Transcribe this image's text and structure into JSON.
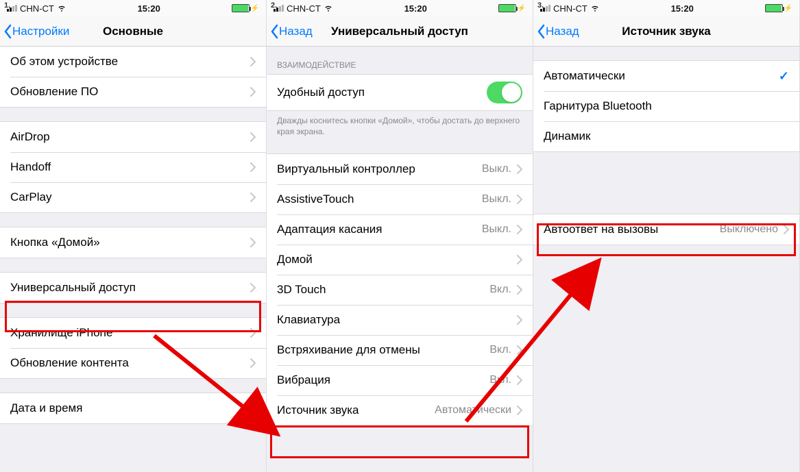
{
  "steps": {
    "s1": "1.",
    "s2": "2.",
    "s3": "3."
  },
  "status": {
    "carrier": "CHN-CT",
    "time": "15:20"
  },
  "screen1": {
    "back": "Настройки",
    "title": "Основные",
    "g1": {
      "r0": "Об этом устройстве",
      "r1": "Обновление ПО"
    },
    "g2": {
      "r0": "AirDrop",
      "r1": "Handoff",
      "r2": "CarPlay"
    },
    "g3": {
      "r0": "Кнопка «Домой»"
    },
    "g4": {
      "r0": "Универсальный доступ"
    },
    "g5": {
      "r0": "Хранилище iPhone",
      "r1": "Обновление контента"
    },
    "g6": {
      "r0": "Дата и время"
    }
  },
  "screen2": {
    "back": "Назад",
    "title": "Универсальный доступ",
    "section_header": "ВЗАИМОДЕЙСТВИЕ",
    "toggle_label": "Удобный доступ",
    "toggle_footer": "Дважды коснитесь кнопки «Домой», чтобы достать до верхнего края экрана.",
    "rows": {
      "r0": {
        "label": "Виртуальный контроллер",
        "detail": "Выкл."
      },
      "r1": {
        "label": "AssistiveTouch",
        "detail": "Выкл."
      },
      "r2": {
        "label": "Адаптация касания",
        "detail": "Выкл."
      },
      "r3": {
        "label": "Домой",
        "detail": ""
      },
      "r4": {
        "label": "3D Touch",
        "detail": "Вкл."
      },
      "r5": {
        "label": "Клавиатура",
        "detail": ""
      },
      "r6": {
        "label": "Встряхивание для отмены",
        "detail": "Вкл."
      },
      "r7": {
        "label": "Вибрация",
        "detail": "Вкл."
      },
      "r8": {
        "label": "Источник звука",
        "detail": "Автоматически"
      }
    }
  },
  "screen3": {
    "back": "Назад",
    "title": "Источник звука",
    "rows": {
      "r0": "Автоматически",
      "r1": "Гарнитура Bluetooth",
      "r2": "Динамик"
    },
    "auto_answer": {
      "label": "Автоответ на вызовы",
      "detail": "Выключено"
    }
  }
}
